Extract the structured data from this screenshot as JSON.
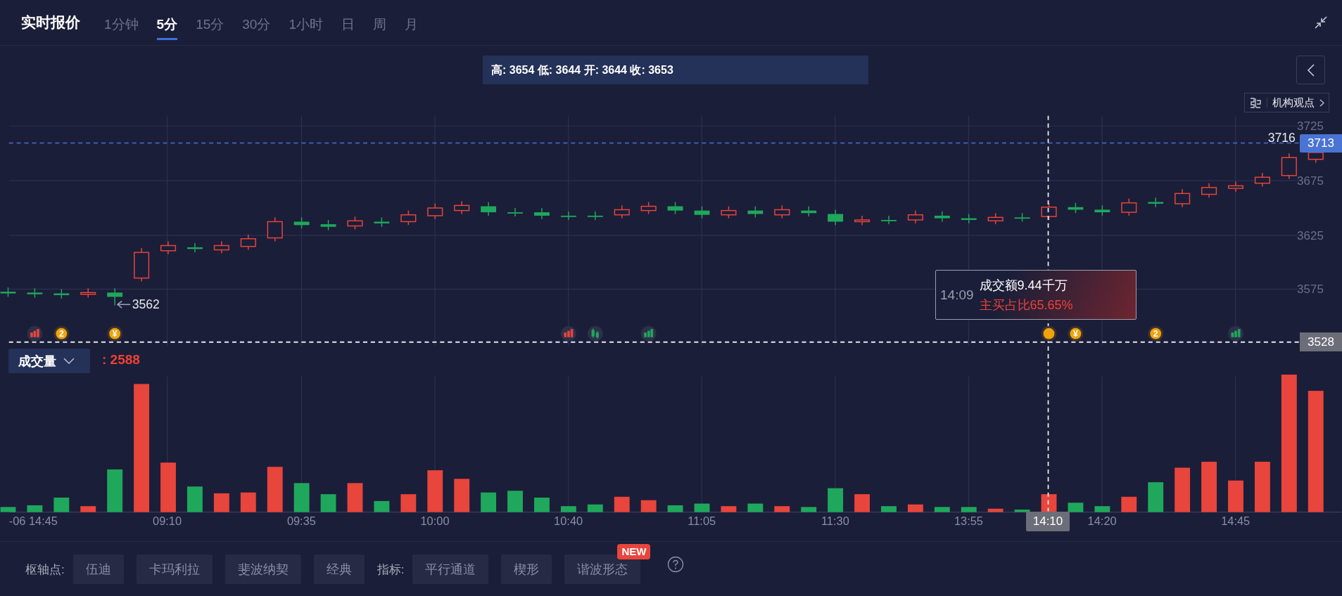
{
  "header": {
    "title": "实时报价",
    "tabs": [
      {
        "label": "1分钟",
        "selected": false
      },
      {
        "label": "5分",
        "selected": true
      },
      {
        "label": "15分",
        "selected": false
      },
      {
        "label": "30分",
        "selected": false
      },
      {
        "label": "1小时",
        "selected": false
      },
      {
        "label": "日",
        "selected": false
      },
      {
        "label": "周",
        "selected": false
      },
      {
        "label": "月",
        "selected": false
      }
    ]
  },
  "chart": {
    "ohlc_summary": "高: 3654 低: 3644 开: 3644 收: 3653",
    "opinion_tag": "机构观点",
    "y_axis_labels": [
      "3725",
      "3675",
      "3625",
      "3575"
    ],
    "max_label": "3716",
    "last_price": "3713",
    "min_label": "3562",
    "crosshair_price": "3528",
    "crosshair_time": "14:10",
    "markers": [
      {
        "kind": "bars",
        "color": "#e8453c"
      },
      {
        "kind": "coin",
        "label": "2"
      },
      {
        "kind": "coin",
        "label": "¥"
      },
      {
        "kind": "bars",
        "color": "#e8453c"
      },
      {
        "kind": "candles",
        "color": "#1fa85c"
      },
      {
        "kind": "bars",
        "color": "#1fa85c"
      },
      {
        "kind": "coin"
      },
      {
        "kind": "coin",
        "label": "¥"
      },
      {
        "kind": "coin",
        "label": "2"
      },
      {
        "kind": "bars",
        "color": "#1fa85c"
      }
    ],
    "tooltip": {
      "time": "14:09",
      "amount": "成交额9.44千万",
      "buy_ratio": "主买占比65.65%"
    },
    "volume": {
      "indicator": "成交量",
      "value": ": 2588"
    },
    "x_axis_labels": [
      "-06 14:45",
      "09:10",
      "09:35",
      "10:00",
      "10:40",
      "11:05",
      "11:30",
      "13:55",
      "14:20",
      "14:45"
    ]
  },
  "toolbar": {
    "pivot_label": "枢轴点:",
    "pivot_buttons": [
      "伍迪",
      "卡玛利拉",
      "斐波纳契",
      "经典"
    ],
    "indicator_label": "指标:",
    "indicator_buttons": [
      {
        "label": "平行通道"
      },
      {
        "label": "楔形"
      },
      {
        "label": "谐波形态",
        "badge": "NEW"
      }
    ]
  }
}
